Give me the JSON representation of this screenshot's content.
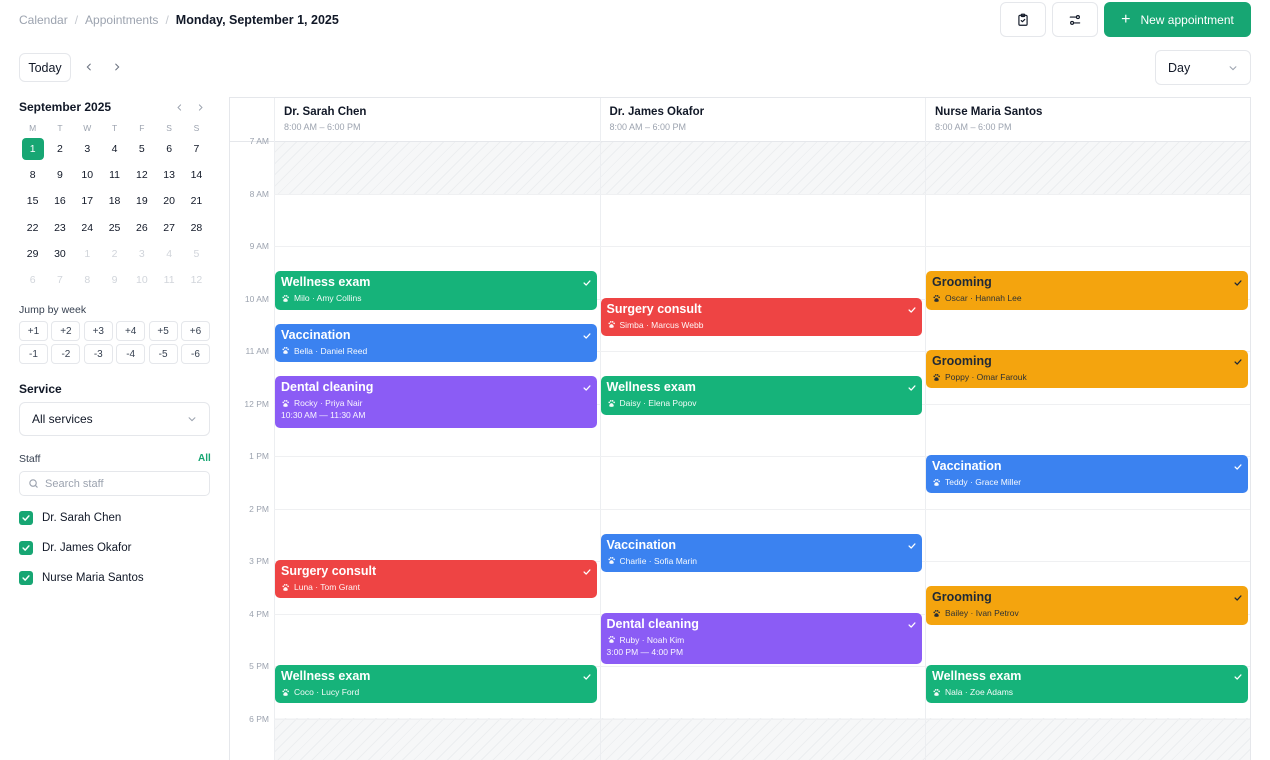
{
  "breadcrumb": [
    "Calendar",
    "Appointments"
  ],
  "breadcrumb_current": "Monday, September 1, 2025",
  "header": {
    "new_appointment": "New appointment",
    "plus": "+",
    "today": "Today",
    "view": "Day"
  },
  "mini_calendar": {
    "title": "September 2025",
    "dow": [
      "M",
      "T",
      "W",
      "T",
      "F",
      "S",
      "S"
    ],
    "weeks": [
      [
        "1",
        "2",
        "3",
        "4",
        "5",
        "6",
        "7"
      ],
      [
        "8",
        "9",
        "10",
        "11",
        "12",
        "13",
        "14"
      ],
      [
        "15",
        "16",
        "17",
        "18",
        "19",
        "20",
        "21"
      ],
      [
        "22",
        "23",
        "24",
        "25",
        "26",
        "27",
        "28"
      ],
      [
        "29",
        "30",
        "1",
        "2",
        "3",
        "4",
        "5"
      ],
      [
        "6",
        "7",
        "8",
        "9",
        "10",
        "11",
        "12"
      ]
    ]
  },
  "jump": {
    "label": "Jump by week",
    "forward": [
      "+1",
      "+2",
      "+3",
      "+4",
      "+5",
      "+6"
    ],
    "back": [
      "-1",
      "-2",
      "-3",
      "-4",
      "-5",
      "-6"
    ]
  },
  "service": {
    "label": "Service",
    "value": "All services"
  },
  "staff": {
    "label": "Staff",
    "all": "All",
    "search_placeholder": "Search staff",
    "members": [
      "Dr. Sarah Chen",
      "Dr. James Okafor",
      "Nurse Maria Santos"
    ]
  },
  "columns": [
    {
      "name": "Dr. Sarah Chen",
      "hours": "8:00 AM – 6:00 PM"
    },
    {
      "name": "Dr. James Okafor",
      "hours": "8:00 AM – 6:00 PM"
    },
    {
      "name": "Nurse Maria Santos",
      "hours": "8:00 AM – 6:00 PM"
    }
  ],
  "time_labels": [
    "7 AM",
    "8 AM",
    "9 AM",
    "10 AM",
    "11 AM",
    "12 PM",
    "1 PM",
    "2 PM",
    "3 PM",
    "4 PM",
    "5 PM",
    "6 PM"
  ],
  "colors": {
    "green": "#16b37a",
    "blue": "#3b82f0",
    "purple": "#8b5cf5",
    "red": "#ee4444",
    "orange": "#f4a40e",
    "accent": "#17a673"
  },
  "events": [
    {
      "col": 0,
      "start": 9.5,
      "end": 10.25,
      "color": "green",
      "title": "Wellness exam",
      "sub": "Milo · Amy Collins"
    },
    {
      "col": 0,
      "start": 10.5,
      "end": 11.25,
      "color": "blue",
      "title": "Vaccination",
      "sub": "Bella · Daniel Reed"
    },
    {
      "col": 0,
      "start": 11.5,
      "end": 12.5,
      "color": "purple",
      "title": "Dental cleaning",
      "sub": "Rocky · Priya Nair",
      "time": "10:30 AM — 11:30 AM"
    },
    {
      "col": 0,
      "start": 15,
      "end": 15.75,
      "color": "red",
      "title": "Surgery consult",
      "sub": "Luna · Tom Grant"
    },
    {
      "col": 0,
      "start": 17,
      "end": 17.75,
      "color": "green",
      "title": "Wellness exam",
      "sub": "Coco · Lucy Ford"
    },
    {
      "col": 1,
      "start": 10,
      "end": 10.75,
      "color": "red",
      "title": "Surgery consult",
      "sub": "Simba · Marcus Webb"
    },
    {
      "col": 1,
      "start": 11.5,
      "end": 12.25,
      "color": "green",
      "title": "Wellness exam",
      "sub": "Daisy · Elena Popov"
    },
    {
      "col": 1,
      "start": 14.5,
      "end": 15.25,
      "color": "blue",
      "title": "Vaccination",
      "sub": "Charlie · Sofia Marin"
    },
    {
      "col": 1,
      "start": 16,
      "end": 17,
      "color": "purple",
      "title": "Dental cleaning",
      "sub": "Ruby · Noah Kim",
      "time": "3:00 PM — 4:00 PM"
    },
    {
      "col": 2,
      "start": 9.5,
      "end": 10.25,
      "color": "orange",
      "title": "Grooming",
      "sub": "Oscar · Hannah Lee"
    },
    {
      "col": 2,
      "start": 11,
      "end": 11.75,
      "color": "orange",
      "title": "Grooming",
      "sub": "Poppy · Omar Farouk"
    },
    {
      "col": 2,
      "start": 13,
      "end": 13.75,
      "color": "blue",
      "title": "Vaccination",
      "sub": "Teddy · Grace Miller"
    },
    {
      "col": 2,
      "start": 15.5,
      "end": 16.25,
      "color": "orange",
      "title": "Grooming",
      "sub": "Bailey · Ivan Petrov"
    },
    {
      "col": 2,
      "start": 17,
      "end": 17.75,
      "color": "green",
      "title": "Wellness exam",
      "sub": "Nala · Zoe Adams"
    }
  ]
}
